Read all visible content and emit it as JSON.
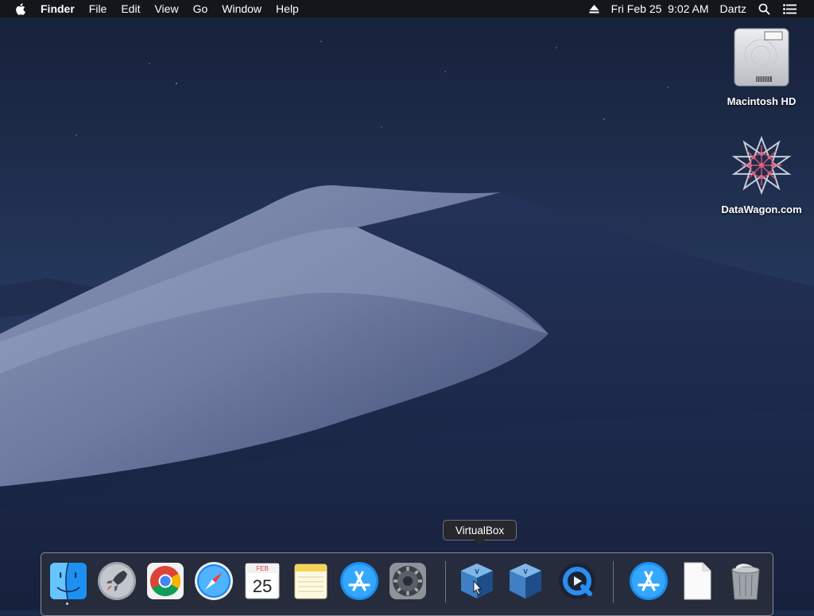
{
  "menubar": {
    "apple_icon": "apple-logo-icon",
    "app_name": "Finder",
    "menus": [
      "File",
      "Edit",
      "View",
      "Go",
      "Window",
      "Help"
    ],
    "status": {
      "eject_icon": "eject-icon",
      "datetime": "Fri Feb 25  9:02 AM",
      "user": "Dartz",
      "search_icon": "spotlight-search-icon",
      "notification_icon": "notification-center-icon"
    }
  },
  "desktop": {
    "icons": [
      {
        "label": "Macintosh HD",
        "icon": "hard-drive-icon"
      },
      {
        "label": "DataWagon.com",
        "icon": "datawagon-logo-icon"
      }
    ]
  },
  "tooltip": {
    "text": "VirtualBox"
  },
  "calendar_icon": {
    "month": "FEB",
    "day": "25"
  },
  "dock": {
    "apps": [
      {
        "name": "Finder",
        "icon": "finder-icon",
        "running": true
      },
      {
        "name": "Launchpad",
        "icon": "launchpad-icon"
      },
      {
        "name": "Google Chrome",
        "icon": "chrome-icon"
      },
      {
        "name": "Safari",
        "icon": "safari-icon"
      },
      {
        "name": "Calendar",
        "icon": "calendar-icon"
      },
      {
        "name": "Notes",
        "icon": "notes-icon"
      },
      {
        "name": "App Store",
        "icon": "app-store-icon"
      },
      {
        "name": "System Preferences",
        "icon": "system-preferences-icon"
      },
      {
        "name": "VirtualBox",
        "icon": "virtualbox-icon",
        "hovered": true
      },
      {
        "name": "VirtualBox",
        "icon": "virtualbox-icon"
      },
      {
        "name": "QuickTime Player",
        "icon": "quicktime-icon"
      },
      {
        "name": "App Store",
        "icon": "app-store-icon"
      },
      {
        "name": "Document",
        "icon": "document-icon"
      },
      {
        "name": "Trash",
        "icon": "trash-icon"
      }
    ]
  },
  "colors": {
    "sky_top": "#16223c",
    "sky_bottom": "#2a3d63",
    "dune_light": "#9aa6c4",
    "dune_shadow": "#1b2747",
    "menubar_bg": "#16161a"
  }
}
